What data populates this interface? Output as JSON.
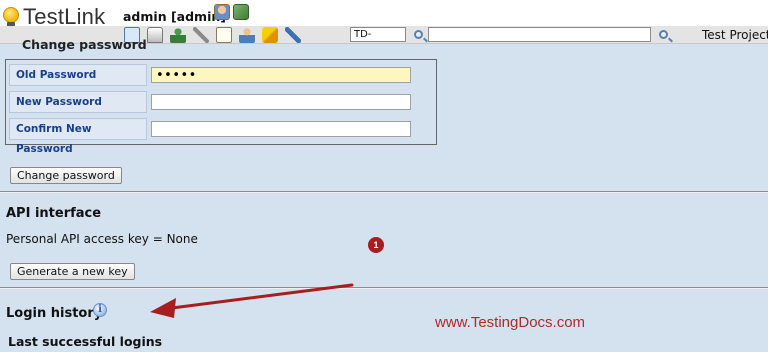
{
  "header": {
    "logo_text": "TestLink",
    "user_label": "admin [admin]",
    "icons": [
      "user-icon",
      "logout-icon"
    ],
    "colors": {
      "logo_bulb": "#f2b400",
      "toolbar_bg": "#e4e4e4"
    }
  },
  "toolbar": {
    "icons": [
      "desktop-icon",
      "cart-icon",
      "tree-icon",
      "wrench-icon",
      "document-icon",
      "person-icon",
      "checkbox-icon",
      "pen-icon"
    ],
    "testcase_input_value": "TD-",
    "search_value": "",
    "project_label": "Test Project |"
  },
  "main": {
    "section_title_cut": "Change password",
    "password_rows": [
      {
        "label": "Old Password",
        "value": "•••••"
      },
      {
        "label": "New Password",
        "value": ""
      },
      {
        "label": "Confirm New Password",
        "value": ""
      }
    ],
    "change_password_button": "Change password",
    "api": {
      "heading": "API interface",
      "key_text": "Personal API access key = None",
      "generate_button": "Generate a new key"
    },
    "login_history": {
      "heading": "Login history",
      "info_icon": "i",
      "last_logins_heading": "Last successful logins"
    },
    "colors": {
      "content_bg": "#d4e1ee",
      "label_text": "#1a3f8a",
      "old_password_bg": "#fdf6bf"
    }
  },
  "annotations": {
    "step_badge": "1",
    "watermark": "www.TestingDocs.com",
    "arrow_color": "#a81e1e"
  }
}
